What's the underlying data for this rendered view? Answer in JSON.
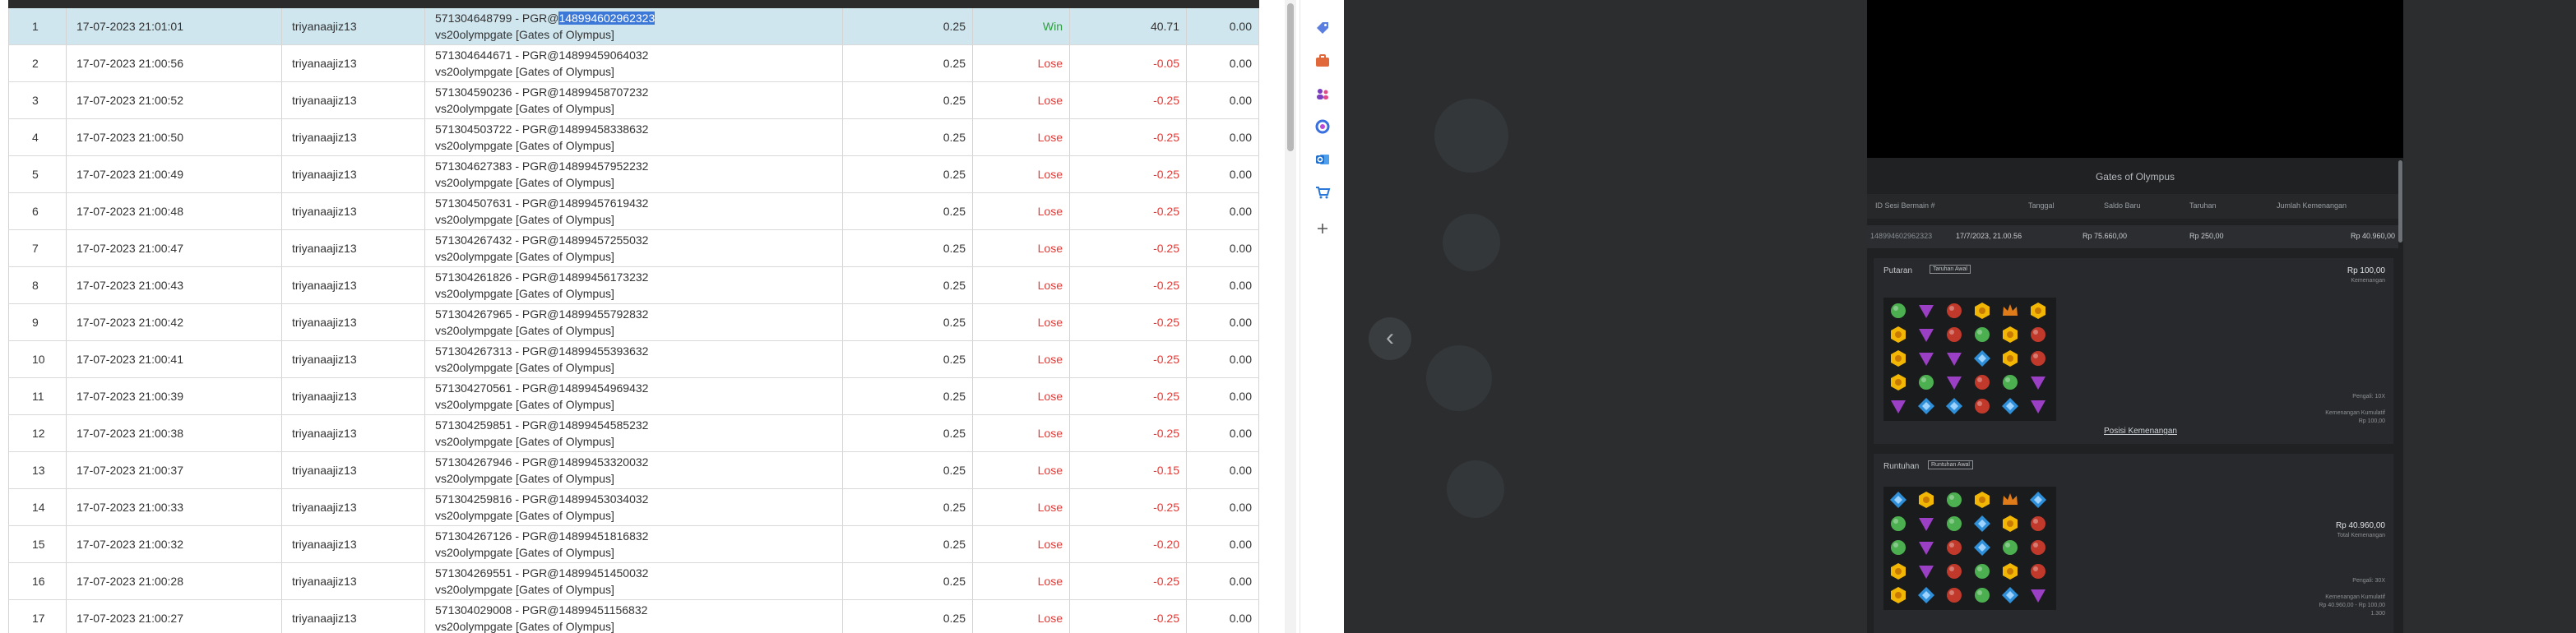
{
  "rows": [
    {
      "no": "1",
      "date": "17-07-2023 21:01:01",
      "user": "triyanaajiz13",
      "ref_a": "571304648799 - PGR@",
      "ref_b": "148994602962323",
      "game": "vs20olympgate [Gates of Olympus]",
      "bet": "0.25",
      "result": "Win",
      "winloss": "40.71",
      "balance": "0.00"
    },
    {
      "no": "2",
      "date": "17-07-2023 21:00:56",
      "user": "triyanaajiz13",
      "ref_a": "571304644671 - PGR@14899459064032",
      "ref_b": "",
      "game": "vs20olympgate [Gates of Olympus]",
      "bet": "0.25",
      "result": "Lose",
      "winloss": "-0.05",
      "balance": "0.00"
    },
    {
      "no": "3",
      "date": "17-07-2023 21:00:52",
      "user": "triyanaajiz13",
      "ref_a": "571304590236 - PGR@14899458707232",
      "ref_b": "",
      "game": "vs20olympgate [Gates of Olympus]",
      "bet": "0.25",
      "result": "Lose",
      "winloss": "-0.25",
      "balance": "0.00"
    },
    {
      "no": "4",
      "date": "17-07-2023 21:00:50",
      "user": "triyanaajiz13",
      "ref_a": "571304503722 - PGR@14899458338632",
      "ref_b": "",
      "game": "vs20olympgate [Gates of Olympus]",
      "bet": "0.25",
      "result": "Lose",
      "winloss": "-0.25",
      "balance": "0.00"
    },
    {
      "no": "5",
      "date": "17-07-2023 21:00:49",
      "user": "triyanaajiz13",
      "ref_a": "571304627383 - PGR@14899457952232",
      "ref_b": "",
      "game": "vs20olympgate [Gates of Olympus]",
      "bet": "0.25",
      "result": "Lose",
      "winloss": "-0.25",
      "balance": "0.00"
    },
    {
      "no": "6",
      "date": "17-07-2023 21:00:48",
      "user": "triyanaajiz13",
      "ref_a": "571304507631 - PGR@14899457619432",
      "ref_b": "",
      "game": "vs20olympgate [Gates of Olympus]",
      "bet": "0.25",
      "result": "Lose",
      "winloss": "-0.25",
      "balance": "0.00"
    },
    {
      "no": "7",
      "date": "17-07-2023 21:00:47",
      "user": "triyanaajiz13",
      "ref_a": "571304267432 - PGR@14899457255032",
      "ref_b": "",
      "game": "vs20olympgate [Gates of Olympus]",
      "bet": "0.25",
      "result": "Lose",
      "winloss": "-0.25",
      "balance": "0.00"
    },
    {
      "no": "8",
      "date": "17-07-2023 21:00:43",
      "user": "triyanaajiz13",
      "ref_a": "571304261826 - PGR@14899456173232",
      "ref_b": "",
      "game": "vs20olympgate [Gates of Olympus]",
      "bet": "0.25",
      "result": "Lose",
      "winloss": "-0.25",
      "balance": "0.00"
    },
    {
      "no": "9",
      "date": "17-07-2023 21:00:42",
      "user": "triyanaajiz13",
      "ref_a": "571304267965 - PGR@14899455792832",
      "ref_b": "",
      "game": "vs20olympgate [Gates of Olympus]",
      "bet": "0.25",
      "result": "Lose",
      "winloss": "-0.25",
      "balance": "0.00"
    },
    {
      "no": "10",
      "date": "17-07-2023 21:00:41",
      "user": "triyanaajiz13",
      "ref_a": "571304267313 - PGR@14899455393632",
      "ref_b": "",
      "game": "vs20olympgate [Gates of Olympus]",
      "bet": "0.25",
      "result": "Lose",
      "winloss": "-0.25",
      "balance": "0.00"
    },
    {
      "no": "11",
      "date": "17-07-2023 21:00:39",
      "user": "triyanaajiz13",
      "ref_a": "571304270561 - PGR@14899454969432",
      "ref_b": "",
      "game": "vs20olympgate [Gates of Olympus]",
      "bet": "0.25",
      "result": "Lose",
      "winloss": "-0.25",
      "balance": "0.00"
    },
    {
      "no": "12",
      "date": "17-07-2023 21:00:38",
      "user": "triyanaajiz13",
      "ref_a": "571304259851 - PGR@14899454585232",
      "ref_b": "",
      "game": "vs20olympgate [Gates of Olympus]",
      "bet": "0.25",
      "result": "Lose",
      "winloss": "-0.25",
      "balance": "0.00"
    },
    {
      "no": "13",
      "date": "17-07-2023 21:00:37",
      "user": "triyanaajiz13",
      "ref_a": "571304267946 - PGR@14899453320032",
      "ref_b": "",
      "game": "vs20olympgate [Gates of Olympus]",
      "bet": "0.25",
      "result": "Lose",
      "winloss": "-0.15",
      "balance": "0.00"
    },
    {
      "no": "14",
      "date": "17-07-2023 21:00:33",
      "user": "triyanaajiz13",
      "ref_a": "571304259816 - PGR@14899453034032",
      "ref_b": "",
      "game": "vs20olympgate [Gates of Olympus]",
      "bet": "0.25",
      "result": "Lose",
      "winloss": "-0.25",
      "balance": "0.00"
    },
    {
      "no": "15",
      "date": "17-07-2023 21:00:32",
      "user": "triyanaajiz13",
      "ref_a": "571304267126 - PGR@14899451816832",
      "ref_b": "",
      "game": "vs20olympgate [Gates of Olympus]",
      "bet": "0.25",
      "result": "Lose",
      "winloss": "-0.20",
      "balance": "0.00"
    },
    {
      "no": "16",
      "date": "17-07-2023 21:00:28",
      "user": "triyanaajiz13",
      "ref_a": "571304269551 - PGR@14899451450032",
      "ref_b": "",
      "game": "vs20olympgate [Gates of Olympus]",
      "bet": "0.25",
      "result": "Lose",
      "winloss": "-0.25",
      "balance": "0.00"
    },
    {
      "no": "17",
      "date": "17-07-2023 21:00:27",
      "user": "triyanaajiz13",
      "ref_a": "571304029008 - PGR@14899451156832",
      "ref_b": "",
      "game": "vs20olympgate [Gates of Olympus]",
      "bet": "0.25",
      "result": "Lose",
      "winloss": "-0.25",
      "balance": "0.00"
    }
  ],
  "extensions": [
    {
      "icon": "tag-icon",
      "color": "#5b7fe0"
    },
    {
      "icon": "briefcase-icon",
      "color": "#e0683a"
    },
    {
      "icon": "people-icon",
      "color": "#7b3fbf"
    },
    {
      "icon": "copilot-icon",
      "color": "#3a6fe0"
    },
    {
      "icon": "outlook-icon",
      "color": "#1e6fd0"
    },
    {
      "icon": "cart-icon",
      "color": "#2b78d8"
    },
    {
      "icon": "plus-icon",
      "color": "#555555"
    }
  ],
  "viewer": {
    "prev_icon": "chevron-left-icon",
    "prev_glyph": "‹",
    "game_title": "Gates of Olympus",
    "info_headers": [
      "ID Sesi Bermain #",
      "Tanggal",
      "Saldo Baru",
      "Taruhan",
      "Jumlah Kemenangan"
    ],
    "info_values": [
      "148994602962323",
      "17/7/2023, 21.00.56",
      "Rp 75.660,00",
      "Rp 250,00",
      "Rp 40.960,00"
    ],
    "spin": {
      "label": "Putaran",
      "button": "Taruhan Awal",
      "amount": "Rp 100,00",
      "amount_sub": "Kemenangan",
      "note_1": "Pengali: 10X",
      "note_2": "Kemenangan Kumulatif",
      "note_3": "Rp 100,00",
      "link": "Posisi Kemenangan"
    },
    "tumble": {
      "label": "Runtuhan",
      "button": "Runtuhan Awal",
      "amount": "Rp 40.960,00",
      "amount_sub": "Total Kemenangan",
      "note_1": "Pengali: 30X",
      "note_2": "Kemenangan Kumulatif",
      "note_3": "Rp 40.960,00 - Rp 100,00",
      "note_4": "1.300"
    }
  }
}
